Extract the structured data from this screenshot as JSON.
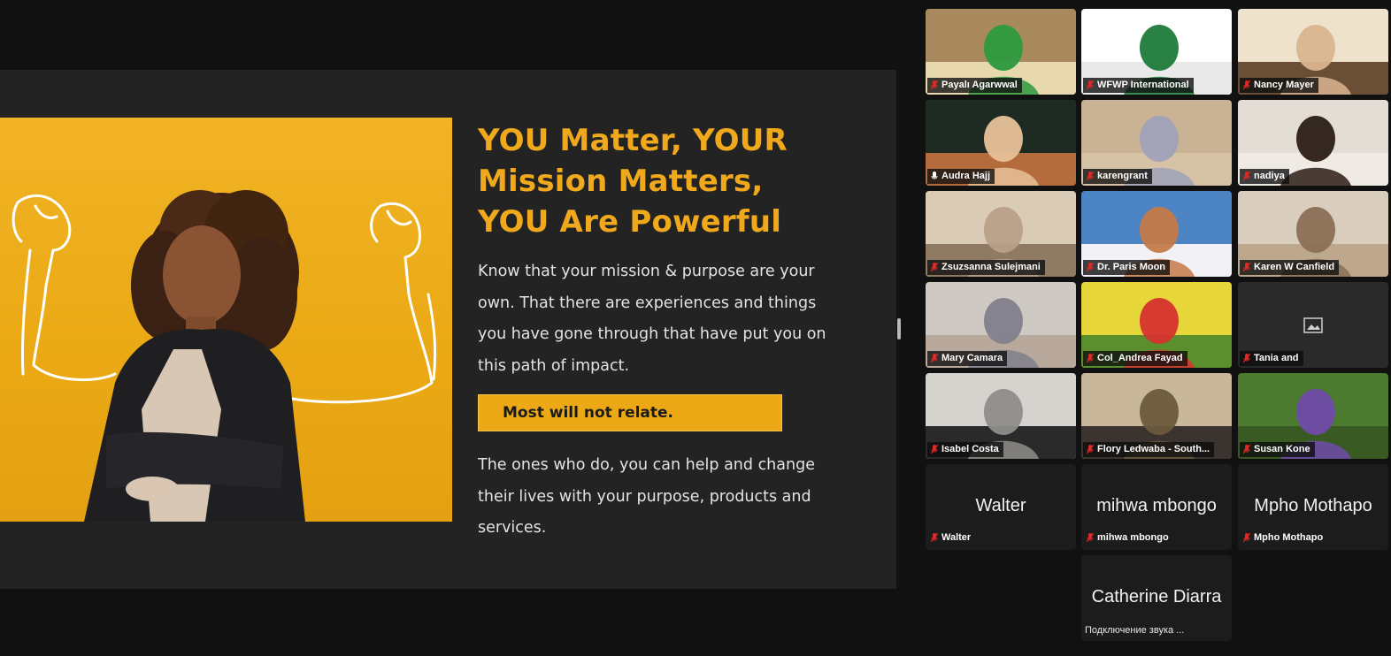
{
  "slide": {
    "title_lines": [
      "YOU Matter, YOUR",
      "Mission Matters,",
      "YOU Are Powerful"
    ],
    "paragraph1_lines": [
      "Know that your mission & purpose are your",
      "own. That there are experiences and things",
      "you have gone through that have put you on",
      "this path of impact."
    ],
    "callout": "Most will not relate.",
    "paragraph2_lines": [
      "The ones who do, you can help and change",
      "their lives with your purpose, products and",
      "services."
    ],
    "colors": {
      "accent": "#f0a91d",
      "photo_bg": "#eaa914",
      "slide_bg": "#232324"
    }
  },
  "participants": [
    {
      "name": "Payalı Agarwwal",
      "icon": "mic-muted-icon"
    },
    {
      "name": "WFWP International",
      "icon": "mic-muted-icon"
    },
    {
      "name": "Nancy Mayer",
      "icon": "mic-muted-icon"
    },
    {
      "name": "Audra Hajj",
      "icon": "mic-icon",
      "active_speaker": true
    },
    {
      "name": "karengrant",
      "icon": "mic-muted-icon"
    },
    {
      "name": "nadiya",
      "icon": "mic-muted-icon"
    },
    {
      "name": "Zsuzsanna Sulejmani",
      "icon": "mic-muted-icon"
    },
    {
      "name": "Dr. Paris Moon",
      "icon": "mic-muted-icon"
    },
    {
      "name": "Karen W Canfield",
      "icon": "mic-muted-icon"
    },
    {
      "name": "Mary Camara",
      "icon": "mic-muted-icon"
    },
    {
      "name": "Col_Andrea Fayad",
      "icon": "mic-muted-icon"
    },
    {
      "name": "Tania and",
      "icon": "mic-muted-icon"
    },
    {
      "name": "Isabel Costa",
      "icon": "mic-muted-icon"
    },
    {
      "name": "Flory Ledwaba - South...",
      "icon": "mic-muted-icon"
    },
    {
      "name": "Susan Kone",
      "icon": "mic-muted-icon"
    },
    {
      "name": "Walter",
      "display_name": "Walter",
      "icon": "mic-muted-icon"
    },
    {
      "name": "mihwa mbongo",
      "display_name": "mihwa mbongo",
      "icon": "mic-muted-icon"
    },
    {
      "name": "Mpho Mothapo",
      "display_name": "Mpho Mothapo",
      "icon": "mic-muted-icon"
    },
    {
      "display_name": "Catherine Diarra",
      "status": "Подключение звука ..."
    }
  ]
}
